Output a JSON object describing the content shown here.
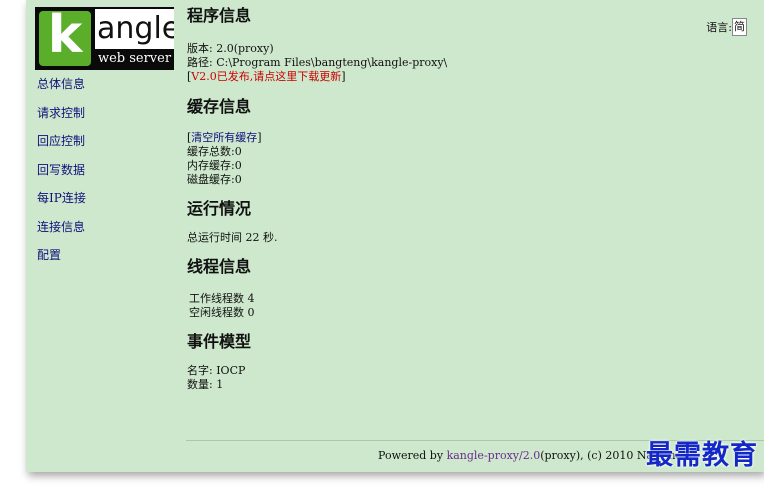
{
  "logo": {
    "letter": "k",
    "word": "angle",
    "sub": "web server"
  },
  "nav": [
    "总体信息",
    "请求控制",
    "回应控制",
    "回写数据",
    "每IP连接",
    "连接信息",
    "配置"
  ],
  "language": {
    "label": "语言:",
    "value": "简"
  },
  "program": {
    "title": "程序信息",
    "version": "版本: 2.0(proxy)",
    "path": "路径: C:\\Program Files\\bangteng\\kangle-proxy\\",
    "update_open": "[",
    "update_link": "V2.0已发布,请点这里下载更新",
    "update_close": "]"
  },
  "cache": {
    "title": "缓存信息",
    "clear_open": "[",
    "clear_link": "清空所有缓存",
    "clear_close": "]",
    "total": "缓存总数:0",
    "memory": "内存缓存:0",
    "disk": "磁盘缓存:0"
  },
  "runtime": {
    "title": "运行情况",
    "uptime": "总运行时间  22 秒."
  },
  "threads": {
    "title": "线程信息",
    "working": "工作线程数 4",
    "idle": "空闲线程数 0"
  },
  "event": {
    "title": "事件模型",
    "name": "名字: IOCP",
    "count": "数量: 1"
  },
  "footer": {
    "prefix": "Powered by ",
    "product": "kangle-proxy/",
    "version": "2.0",
    "suffix": "(proxy), (c) 2010 NanChang"
  },
  "watermark": "最需教育"
}
